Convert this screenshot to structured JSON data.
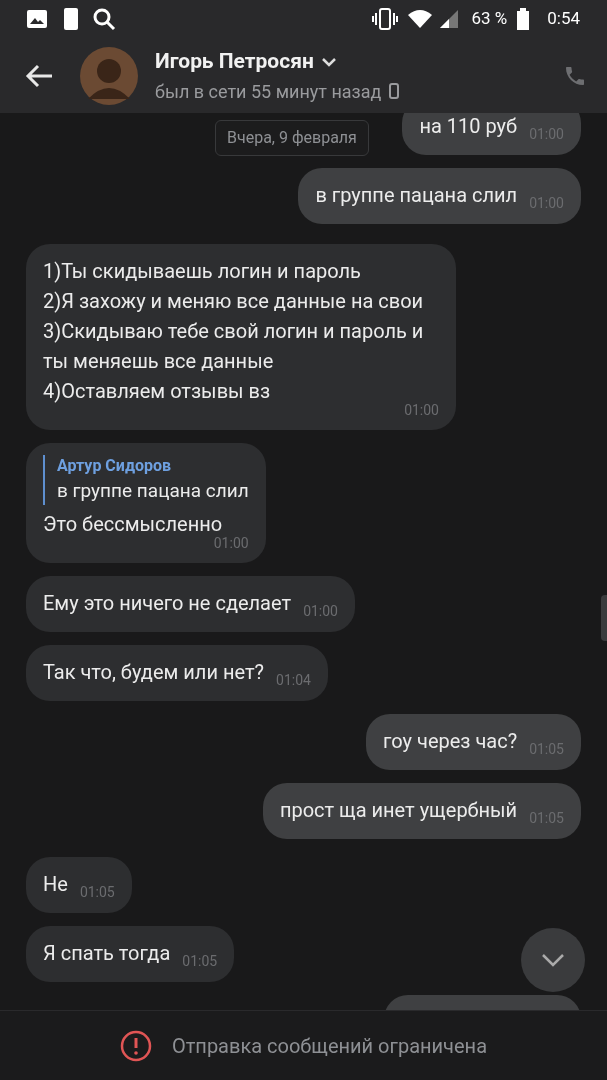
{
  "status_bar": {
    "battery": "63 %",
    "time": "0:54"
  },
  "header": {
    "name": "Игорь Петросян",
    "status": "был в сети 55 минут назад"
  },
  "date_chip": "Вчера, 9 февраля",
  "messages": [
    {
      "kind": "out",
      "text": "на 110 руб",
      "time": "01:00"
    },
    {
      "kind": "out",
      "text": "в группе пацана слил",
      "time": "01:00"
    },
    {
      "kind": "in",
      "text": "1)Ты скидываешь логин и пароль\n2)Я захожу и меняю все данные на свои\n3)Скидываю тебе свой логин и пароль и ты меняешь все данные\n4)Оставляем отзывы вз",
      "time": "01:00"
    },
    {
      "kind": "in",
      "reply": {
        "author": "Артур Сидоров",
        "text": "в группе пацана слил"
      },
      "text": "Это бессмысленно",
      "time": "01:00"
    },
    {
      "kind": "in",
      "text": "Ему это ничего не сделает",
      "time": "01:00"
    },
    {
      "kind": "in",
      "text": "Так что, будем или нет?",
      "time": "01:04"
    },
    {
      "kind": "out",
      "text": "гоу через час?",
      "time": "01:05"
    },
    {
      "kind": "out",
      "text": "прост ща инет ущербный",
      "time": "01:05"
    },
    {
      "kind": "in",
      "text": "Не",
      "time": "01:05"
    },
    {
      "kind": "in",
      "text": "Я спать тогда",
      "time": "01:05"
    },
    {
      "kind": "cut"
    }
  ],
  "footer": {
    "notice": "Отправка сообщений ограничена"
  }
}
